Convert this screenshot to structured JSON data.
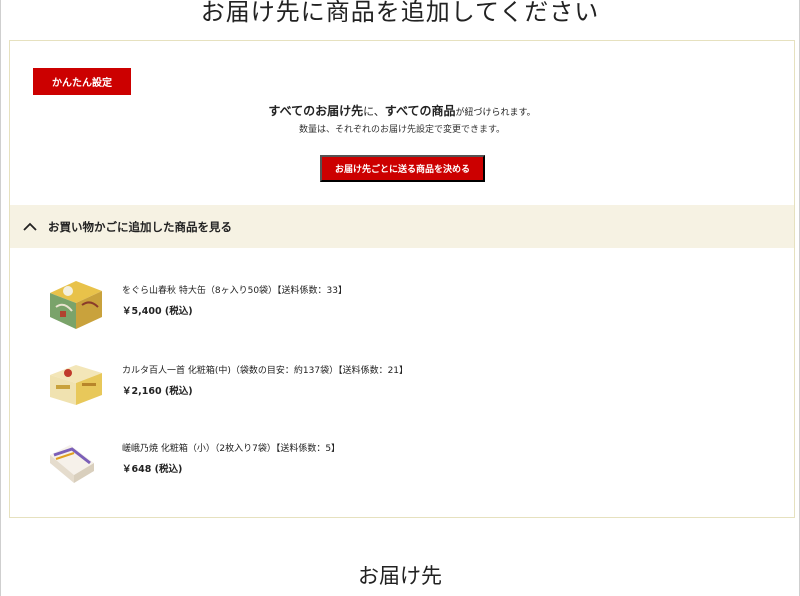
{
  "page_title": "お届け先に商品を追加してください",
  "kantan_button": "かんたん設定",
  "info": {
    "line1_part1": "すべてのお届け先",
    "line1_part2": "に、",
    "line1_part3": "すべての商品",
    "line1_part4": "が紐づけられます。",
    "line2": "数量は、それぞれのお届け先設定で変更できます。"
  },
  "decide_button": "お届け先ごとに送る商品を決める",
  "cart_toggle_label": "お買い物かごに追加した商品を見る",
  "items": [
    {
      "name": "をぐら山春秋 特大缶（8ヶ入り50袋）【送料係数：33】",
      "price": "￥5,400 (税込)"
    },
    {
      "name": "カルタ百人一首 化粧箱(中)（袋数の目安：約137袋）【送料係数：21】",
      "price": "￥2,160 (税込)"
    },
    {
      "name": "嵯峨乃焼 化粧箱（小）（2枚入り7袋）【送料係数：5】",
      "price": "￥648 (税込)"
    }
  ],
  "section_title": "お届け先",
  "colors": {
    "accent_red": "#cc0000",
    "toggle_bg": "#f6f2e3",
    "panel_border": "#e6e1bf"
  }
}
